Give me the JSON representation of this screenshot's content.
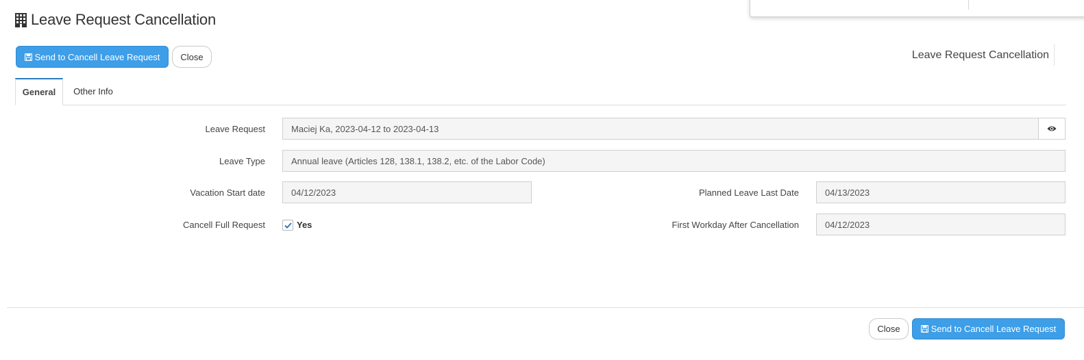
{
  "page": {
    "title": "Leave Request Cancellation",
    "title_icon": "building-icon",
    "header_label": "Leave Request Cancellation"
  },
  "toolbar": {
    "send_label": "Send to Cancell Leave Request",
    "close_label": "Close",
    "send_icon": "save-icon"
  },
  "tabs": [
    {
      "label": "General",
      "active": true
    },
    {
      "label": "Other Info",
      "active": false
    }
  ],
  "form": {
    "leave_request": {
      "label": "Leave Request",
      "value": "Maciej Ka, 2023-04-12 to 2023-04-13",
      "action_icon": "eye-icon"
    },
    "leave_type": {
      "label": "Leave Type",
      "value": "Annual leave (Articles 128, 138.1, 138.2, etc. of the Labor Code)"
    },
    "vacation_start": {
      "label": "Vacation Start date",
      "value": "04/12/2023"
    },
    "planned_last": {
      "label": "Planned Leave Last Date",
      "value": "04/13/2023"
    },
    "cancel_full": {
      "label": "Cancell Full Request",
      "checked": true,
      "option": "Yes"
    },
    "first_workday": {
      "label": "First Workday After Cancellation",
      "value": "04/12/2023"
    }
  },
  "footer": {
    "close_label": "Close",
    "send_label": "Send to Cancell Leave Request"
  },
  "colors": {
    "primary": "#3e9ee8",
    "tab_accent": "#2b7bbf",
    "field_bg": "#f5f5f5",
    "check": "#2b7bbf"
  }
}
